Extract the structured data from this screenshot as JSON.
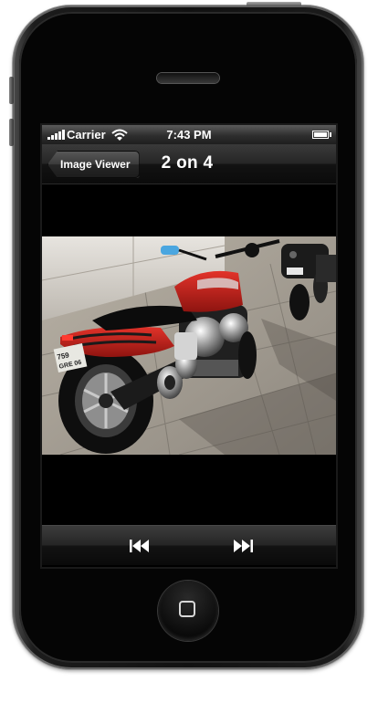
{
  "status_bar": {
    "carrier": "Carrier",
    "time": "7:43 PM"
  },
  "nav_bar": {
    "back_label": "Image Viewer",
    "title": "2 on 4"
  },
  "photo": {
    "plate_text": "759 GRE 06"
  },
  "toolbar": {
    "prev_icon": "rewind-icon",
    "next_icon": "fast-forward-icon"
  },
  "colors": {
    "motorcycle_red": "#c8231c",
    "bar_dark": "#1a1a1a"
  }
}
